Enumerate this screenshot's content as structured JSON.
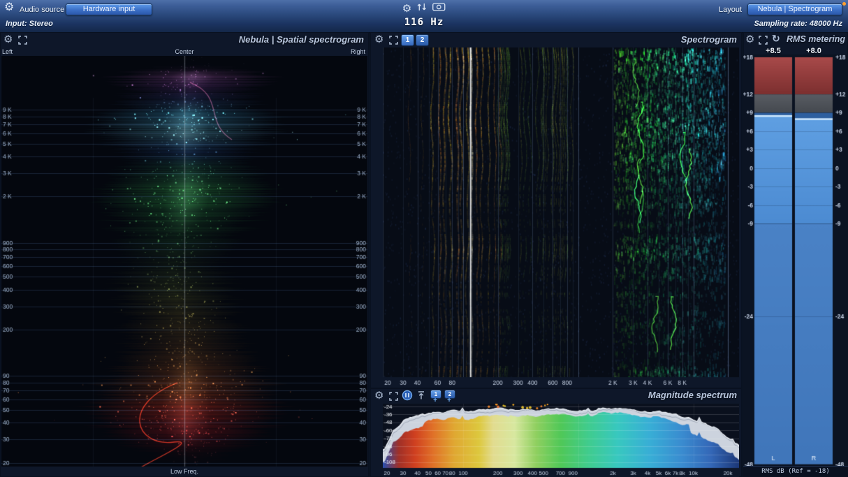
{
  "topbar": {
    "audio_source_label": "Audio source",
    "hardware_input_button": "Hardware input",
    "input_info": "Input: Stereo",
    "freq_readout": "116 Hz",
    "layout_label": "Layout",
    "layout_preset_button": "Nebula | Spectrogram",
    "sampling_rate": "Sampling rate: 48000 Hz"
  },
  "spatial_panel": {
    "title": "Nebula | Spatial spectrogram",
    "axis_left": "Left",
    "axis_center": "Center",
    "axis_right": "Right",
    "axis_bottom": "Low Freq.",
    "freq_ticks": [
      {
        "f": 9000,
        "label": "9 K"
      },
      {
        "f": 8000,
        "label": "8 K"
      },
      {
        "f": 7000,
        "label": "7 K"
      },
      {
        "f": 6000,
        "label": "6 K"
      },
      {
        "f": 5000,
        "label": "5 K"
      },
      {
        "f": 4000,
        "label": "4 K"
      },
      {
        "f": 3000,
        "label": "3 K"
      },
      {
        "f": 2000,
        "label": "2 K"
      },
      {
        "f": 900,
        "label": "900"
      },
      {
        "f": 800,
        "label": "800"
      },
      {
        "f": 700,
        "label": "700"
      },
      {
        "f": 600,
        "label": "600"
      },
      {
        "f": 500,
        "label": "500"
      },
      {
        "f": 400,
        "label": "400"
      },
      {
        "f": 300,
        "label": "300"
      },
      {
        "f": 200,
        "label": "200"
      },
      {
        "f": 90,
        "label": "90"
      },
      {
        "f": 80,
        "label": "80"
      },
      {
        "f": 70,
        "label": "70"
      },
      {
        "f": 60,
        "label": "60"
      },
      {
        "f": 50,
        "label": "50"
      },
      {
        "f": 40,
        "label": "40"
      },
      {
        "f": 30,
        "label": "30"
      },
      {
        "f": 20,
        "label": "20"
      }
    ]
  },
  "spectrogram_panel": {
    "title": "Spectrogram",
    "preset_buttons": [
      "1",
      "2"
    ],
    "marker_freq_hz": 116,
    "x_ticks": [
      {
        "f": 20,
        "label": "20"
      },
      {
        "f": 30,
        "label": "30"
      },
      {
        "f": 40,
        "label": "40"
      },
      {
        "f": 60,
        "label": "60"
      },
      {
        "f": 80,
        "label": "80"
      },
      {
        "f": 200,
        "label": "200"
      },
      {
        "f": 300,
        "label": "300"
      },
      {
        "f": 400,
        "label": "400"
      },
      {
        "f": 600,
        "label": "600"
      },
      {
        "f": 800,
        "label": "800"
      },
      {
        "f": 2000,
        "label": "2 K"
      },
      {
        "f": 3000,
        "label": "3 K"
      },
      {
        "f": 4000,
        "label": "4 K"
      },
      {
        "f": 6000,
        "label": "6 K"
      },
      {
        "f": 8000,
        "label": "8 K"
      }
    ]
  },
  "magnitude_panel": {
    "title": "Magnitude spectrum",
    "preset_buttons": [
      "1",
      "2"
    ],
    "y_ticks": [
      {
        "db": -24,
        "label": "-24"
      },
      {
        "db": -36,
        "label": "-36"
      },
      {
        "db": -48,
        "label": "-48"
      },
      {
        "db": -60,
        "label": "-60"
      },
      {
        "db": -72,
        "label": "-72"
      },
      {
        "db": -84,
        "label": "-84"
      },
      {
        "db": -96,
        "label": "-96"
      },
      {
        "db": -108,
        "label": "-108"
      }
    ],
    "x_ticks": [
      {
        "f": 20,
        "label": "20"
      },
      {
        "f": 30,
        "label": "30"
      },
      {
        "f": 40,
        "label": "40"
      },
      {
        "f": 50,
        "label": "50"
      },
      {
        "f": 60,
        "label": "60"
      },
      {
        "f": 70,
        "label": "70"
      },
      {
        "f": 80,
        "label": "80"
      },
      {
        "f": 100,
        "label": "100"
      },
      {
        "f": 200,
        "label": "200"
      },
      {
        "f": 300,
        "label": "300"
      },
      {
        "f": 400,
        "label": "400"
      },
      {
        "f": 500,
        "label": "500"
      },
      {
        "f": 700,
        "label": "700"
      },
      {
        "f": 900,
        "label": "900"
      },
      {
        "f": 2000,
        "label": "2k"
      },
      {
        "f": 3000,
        "label": "3k"
      },
      {
        "f": 4000,
        "label": "4k"
      },
      {
        "f": 5000,
        "label": "5k"
      },
      {
        "f": 6000,
        "label": "6k"
      },
      {
        "f": 7000,
        "label": "7k"
      },
      {
        "f": 8000,
        "label": "8k"
      },
      {
        "f": 10000,
        "label": "10k"
      },
      {
        "f": 20000,
        "label": "20k"
      }
    ]
  },
  "rms_panel": {
    "title": "RMS metering",
    "meters": [
      {
        "channel": "L",
        "value_db": 8.5,
        "value_label": "+8.5"
      },
      {
        "channel": "R",
        "value_db": 8.0,
        "value_label": "+8.0"
      }
    ],
    "scale_ticks": [
      {
        "db": 18,
        "label": "+18"
      },
      {
        "db": 12,
        "label": "+12"
      },
      {
        "db": 9,
        "label": "+9"
      },
      {
        "db": 6,
        "label": "+6"
      },
      {
        "db": 3,
        "label": "+3"
      },
      {
        "db": 0,
        "label": "0"
      },
      {
        "db": -3,
        "label": "-3"
      },
      {
        "db": -6,
        "label": "-6"
      },
      {
        "db": -9,
        "label": "-9"
      },
      {
        "db": -24,
        "label": "-24"
      },
      {
        "db": -48,
        "label": "-48"
      }
    ],
    "footer": "RMS dB (Ref = -18)"
  }
}
